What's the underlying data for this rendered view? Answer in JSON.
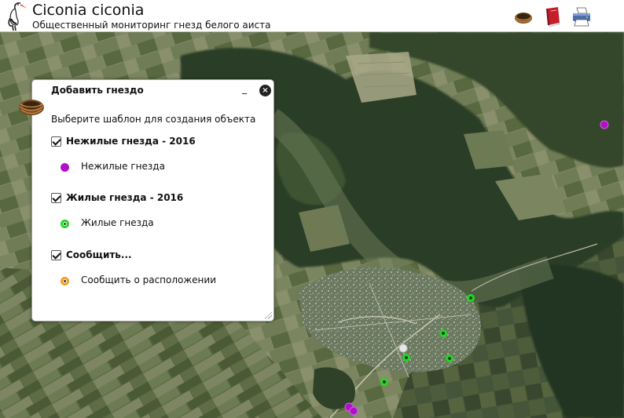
{
  "header": {
    "title": "Ciconia ciconia",
    "subtitle": "Общественный мониторинг гнезд белого аиста",
    "logo_icon": "stork-icon",
    "tools": [
      {
        "name": "add-nest-tool",
        "icon": "nest-icon"
      },
      {
        "name": "layers-tool",
        "icon": "book-icon"
      },
      {
        "name": "print-tool",
        "icon": "printer-icon"
      }
    ]
  },
  "panel": {
    "title": "Добавить гнездо",
    "minimize": "_",
    "close": "×",
    "instruction": "Выберите шаблон для создания объекта",
    "layers": [
      {
        "name": "Нежилые гнезда - 2016",
        "checked": true,
        "template": "Нежилые гнезда",
        "color": "#b010c8",
        "style": "solid"
      },
      {
        "name": "Жилые гнезда - 2016",
        "checked": true,
        "template": "Жилые гнезда",
        "color": "#22d822",
        "style": "ring"
      },
      {
        "name": "Сообщить...",
        "checked": true,
        "template": "Сообщить о расположении",
        "color": "#f0a020",
        "style": "ring"
      }
    ]
  },
  "map": {
    "basemap": "satellite",
    "markers": [
      {
        "type": "uninhabited",
        "color": "#b010c8"
      },
      {
        "type": "uninhabited",
        "color": "#b010c8"
      },
      {
        "type": "uninhabited",
        "color": "#b010c8"
      },
      {
        "type": "inhabited",
        "color": "#22d822"
      },
      {
        "type": "inhabited",
        "color": "#22d822"
      },
      {
        "type": "inhabited",
        "color": "#22d822"
      },
      {
        "type": "inhabited",
        "color": "#22d822"
      },
      {
        "type": "inhabited",
        "color": "#22d822"
      },
      {
        "type": "other",
        "color": "#e8e8e8"
      }
    ]
  }
}
